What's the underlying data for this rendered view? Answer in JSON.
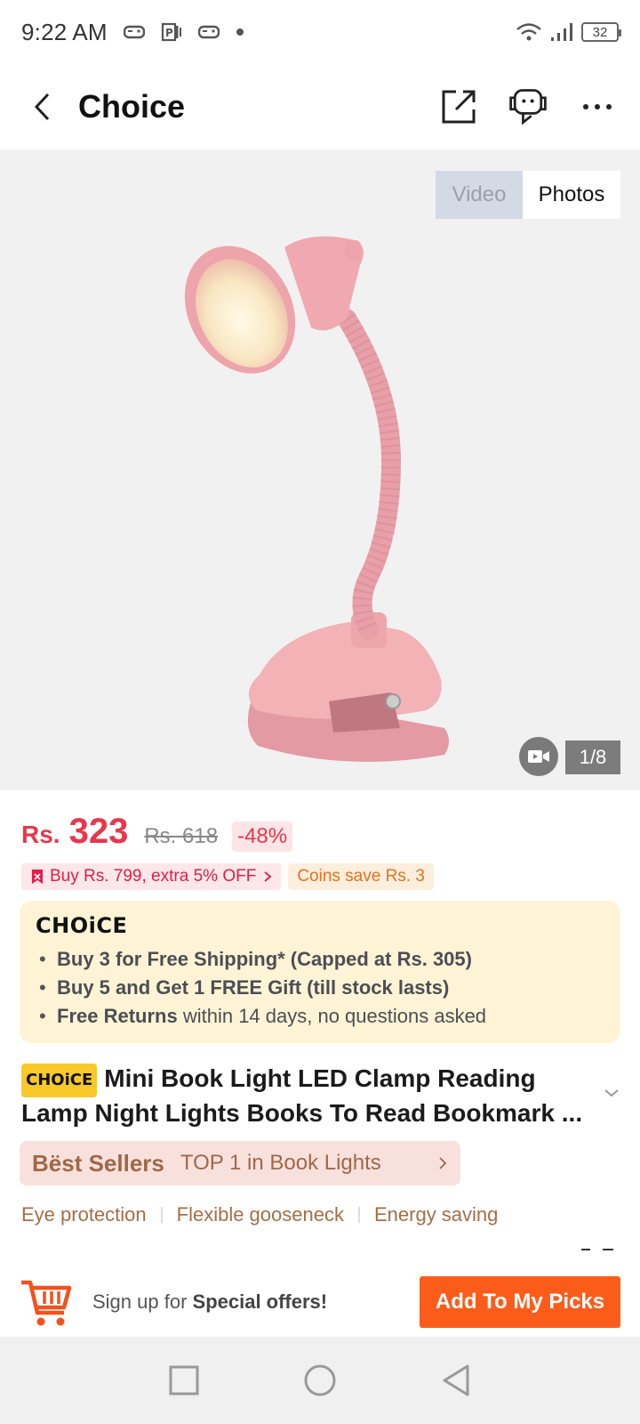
{
  "status_bar": {
    "time": "9:22 AM",
    "battery": "32"
  },
  "header": {
    "title": "Choice"
  },
  "gallery": {
    "video_label": "Video",
    "photos_label": "Photos",
    "counter": "1/8"
  },
  "price": {
    "currency": "Rs.",
    "amount": "323",
    "original": "Rs. 618",
    "discount": "-48%"
  },
  "promos": {
    "buy_offer": "Buy Rs. 799, extra 5% OFF",
    "coins": "Coins save Rs. 3"
  },
  "choice": {
    "logo": "CHOiCE",
    "bullet1_bold": "Buy 3 for  Free Shipping* (Capped at Rs. 305)",
    "bullet2_bold": "Buy 5 and Get 1 FREE Gift (till stock lasts)",
    "bullet3_bold": "Free Returns",
    "bullet3_rest": " within 14 days, no questions asked"
  },
  "product": {
    "badge": "CHOiCE",
    "title": "Mini Book Light LED Clamp Reading Lamp Night Lights Books To Read Bookmark ..."
  },
  "bestsellers": {
    "brand": "Bëst Sellers",
    "text": "TOP 1 in Book Lights"
  },
  "features": [
    "Eye protection",
    "Flexible gooseneck",
    "Energy saving"
  ],
  "action_bar": {
    "signup_prefix": "Sign up for ",
    "signup_bold": "Special offers!",
    "button": "Add To My Picks"
  },
  "colors": {
    "price_red": "#e8374c",
    "accent_orange": "#fc5c1a",
    "choice_bg": "#fef4d5",
    "bestseller_bg": "#f8e1dc",
    "feature_brown": "#a56e45"
  }
}
